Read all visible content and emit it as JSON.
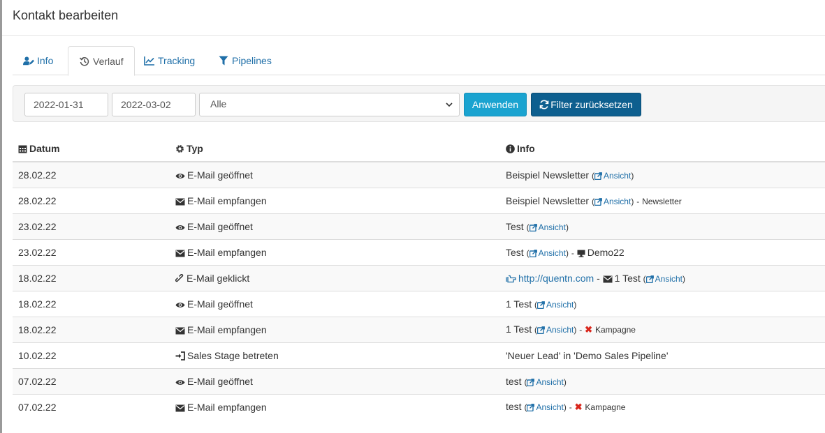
{
  "header": {
    "title": "Kontakt bearbeiten"
  },
  "tabs": [
    {
      "label": "Info",
      "icon": "user-edit-icon"
    },
    {
      "label": "Verlauf",
      "icon": "history-icon"
    },
    {
      "label": "Tracking",
      "icon": "chart-line-icon"
    },
    {
      "label": "Pipelines",
      "icon": "filter-icon"
    }
  ],
  "filter": {
    "date_from": "2022-01-31",
    "date_to": "2022-03-02",
    "type_selected": "Alle",
    "apply_label": "Anwenden",
    "reset_label": "Filter zurücksetzen"
  },
  "table": {
    "headers": {
      "date": "Datum",
      "type": "Typ",
      "info": "Info"
    },
    "rows": [
      {
        "date": "28.02.22",
        "type": "E-Mail geöffnet",
        "info": "Beispiel Newsletter",
        "link": "Ansicht",
        "extra": ""
      },
      {
        "date": "28.02.22",
        "type": "E-Mail empfangen",
        "info": "Beispiel Newsletter",
        "link": "Ansicht",
        "extra": "Newsletter"
      },
      {
        "date": "23.02.22",
        "type": "E-Mail geöffnet",
        "info": "Test",
        "link": "Ansicht",
        "extra": ""
      },
      {
        "date": "23.02.22",
        "type": "E-Mail empfangen",
        "info": "Test",
        "link": "Ansicht",
        "extra": "Demo22"
      },
      {
        "date": "18.02.22",
        "type": "E-Mail geklickt",
        "url": "http://quentn.com",
        "info": "1 Test",
        "link": "Ansicht",
        "extra": ""
      },
      {
        "date": "18.02.22",
        "type": "E-Mail geöffnet",
        "info": "1 Test",
        "link": "Ansicht",
        "extra": ""
      },
      {
        "date": "18.02.22",
        "type": "E-Mail empfangen",
        "info": "1 Test",
        "link": "Ansicht",
        "extra": "Kampagne"
      },
      {
        "date": "10.02.22",
        "type": "Sales Stage betreten",
        "info": "'Neuer Lead' in 'Demo Sales Pipeline'",
        "link": "",
        "extra": ""
      },
      {
        "date": "07.02.22",
        "type": "E-Mail geöffnet",
        "info": "test",
        "link": "Ansicht",
        "extra": ""
      },
      {
        "date": "07.02.22",
        "type": "E-Mail empfangen",
        "info": "test",
        "link": "Ansicht",
        "extra": "Kampagne"
      }
    ]
  },
  "colors": {
    "link": "#1f6fa8",
    "apply": "#1aa3d0",
    "reset": "#0d5f8f",
    "remove": "#d9261c"
  }
}
